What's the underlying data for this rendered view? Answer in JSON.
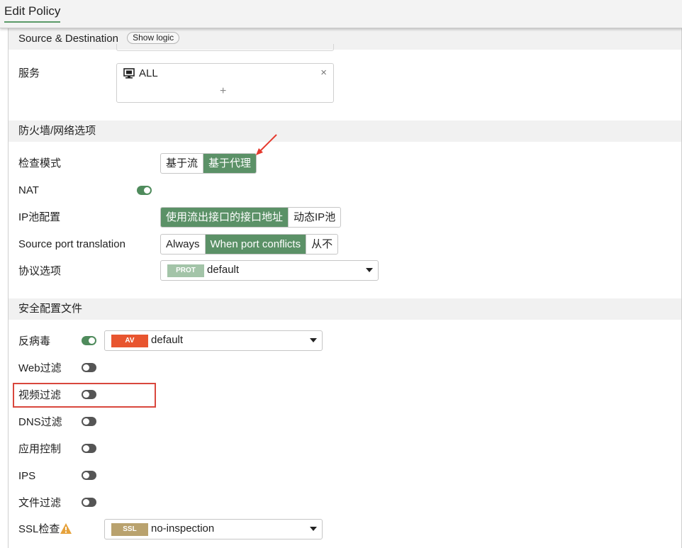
{
  "header": {
    "title": "Edit Policy"
  },
  "source_destination": {
    "title": "Source & Destination",
    "show_logic_label": "Show logic"
  },
  "service": {
    "label": "服务",
    "value": "ALL",
    "close_symbol": "×",
    "add_symbol": "+"
  },
  "firewall_section": {
    "title": "防火墙/网络选项"
  },
  "inspection_mode": {
    "label": "检查模式",
    "options": [
      "基于流",
      "基于代理"
    ],
    "selected": "基于代理"
  },
  "nat": {
    "label": "NAT",
    "enabled": true
  },
  "ip_pool": {
    "label": "IP池配置",
    "options": [
      "使用流出接口的接口地址",
      "动态IP池"
    ],
    "selected": "使用流出接口的接口地址"
  },
  "source_port_translation": {
    "label": "Source port translation",
    "options": [
      "Always",
      "When port conflicts",
      "从不"
    ],
    "selected": "When port conflicts"
  },
  "protocol_options": {
    "label": "协议选项",
    "tag": "PROT",
    "value": "default"
  },
  "security_section": {
    "title": "安全配置文件"
  },
  "antivirus": {
    "label": "反病毒",
    "enabled": true,
    "tag": "AV",
    "value": "default"
  },
  "web_filter": {
    "label": "Web过滤",
    "enabled": false
  },
  "video_filter": {
    "label": "视频过滤",
    "enabled": false
  },
  "dns_filter": {
    "label": "DNS过滤",
    "enabled": false
  },
  "app_control": {
    "label": "应用控制",
    "enabled": false
  },
  "ips": {
    "label": "IPS",
    "enabled": false
  },
  "file_filter": {
    "label": "文件过滤",
    "enabled": false
  },
  "ssl_inspection": {
    "label": "SSL检查",
    "tag": "SSL",
    "value": "no-inspection",
    "warning_icon": "warning-triangle-icon"
  },
  "colors": {
    "accent_green": "#5b9167",
    "av_tag": "#e8552f",
    "prot_tag": "#a3c4a8",
    "ssl_tag": "#b9a26e",
    "highlight_red": "#d9473d",
    "arrow_red": "#e53a2e",
    "warning": "#e6a23c"
  }
}
